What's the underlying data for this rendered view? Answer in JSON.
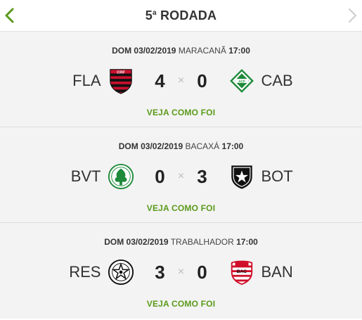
{
  "header": {
    "round_number": "5",
    "round_ordinal": "a",
    "round_word": "RODADA",
    "prev_icon": "chevron-left-icon",
    "next_icon": "chevron-right-icon"
  },
  "colors": {
    "accent_green": "#5a9a1a",
    "disabled_arrow": "#cccccc"
  },
  "matches": [
    {
      "date": "DOM 03/02/2019",
      "venue": "MARACANÃ",
      "time": "17:00",
      "home": {
        "abbr": "FLA",
        "crest": "flamengo-crest-icon"
      },
      "away": {
        "abbr": "CAB",
        "crest": "cabofriense-crest-icon"
      },
      "home_score": "4",
      "away_score": "0",
      "separator": "×",
      "link_label": "VEJA COMO FOI"
    },
    {
      "date": "DOM 03/02/2019",
      "venue": "BACAXÁ",
      "time": "17:00",
      "home": {
        "abbr": "BVT",
        "crest": "boavista-crest-icon"
      },
      "away": {
        "abbr": "BOT",
        "crest": "botafogo-crest-icon"
      },
      "home_score": "0",
      "away_score": "3",
      "separator": "×",
      "link_label": "VEJA COMO FOI"
    },
    {
      "date": "DOM 03/02/2019",
      "venue": "TRABALHADOR",
      "time": "17:00",
      "home": {
        "abbr": "RES",
        "crest": "resende-crest-icon"
      },
      "away": {
        "abbr": "BAN",
        "crest": "bangu-crest-icon"
      },
      "home_score": "3",
      "away_score": "0",
      "separator": "×",
      "link_label": "VEJA COMO FOI"
    }
  ]
}
